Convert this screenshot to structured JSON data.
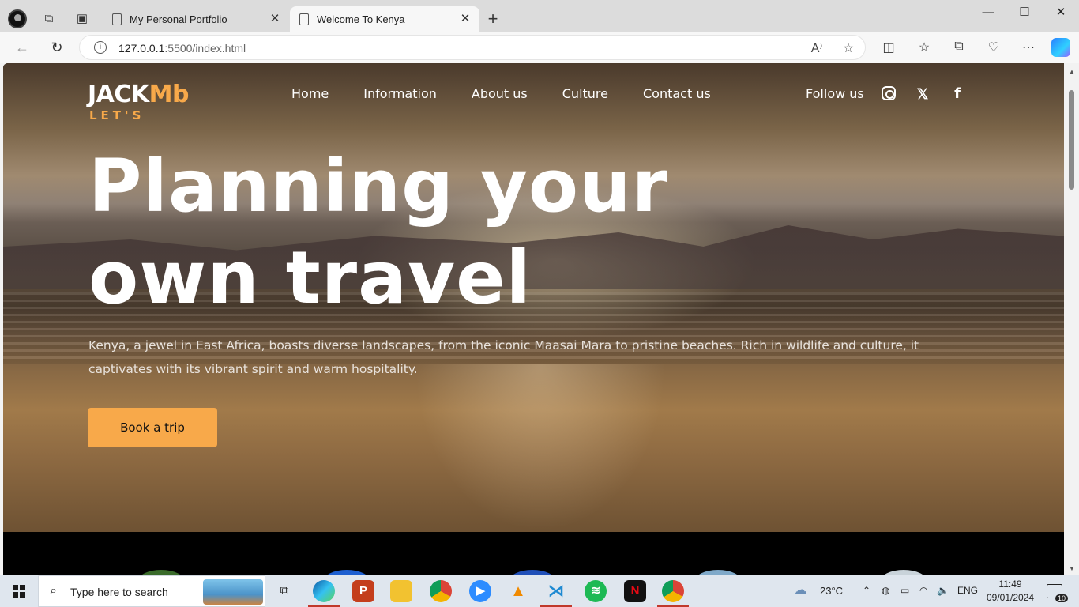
{
  "browser": {
    "tabs": [
      {
        "title": "My Personal Portfolio",
        "active": false
      },
      {
        "title": "Welcome To Kenya",
        "active": true
      }
    ],
    "address": {
      "host": "127.0.0.1",
      "rest": ":5500/index.html"
    }
  },
  "site": {
    "logo": {
      "part1": "JACK",
      "part2": "Mb",
      "tagline": "LET'S"
    },
    "nav": [
      "Home",
      "Information",
      "About us",
      "Culture",
      "Contact us"
    ],
    "follow_label": "Follow us",
    "social_icons": [
      "instagram-icon",
      "x-icon",
      "facebook-icon"
    ],
    "headline_line1": "Planning your",
    "headline_line2": "own travel",
    "lead": "Kenya, a jewel in East Africa, boasts diverse landscapes, from the iconic Maasai Mara to pristine beaches. Rich in wildlife and culture, it captivates with its vibrant spirit and warm hospitality.",
    "cta": "Book a trip",
    "accent_color": "#f8a94a"
  },
  "taskbar": {
    "search_placeholder": "Type here to search",
    "weather": "23°C",
    "language": "ENG",
    "time": "11:49",
    "date": "09/01/2024",
    "notifications": "10"
  }
}
